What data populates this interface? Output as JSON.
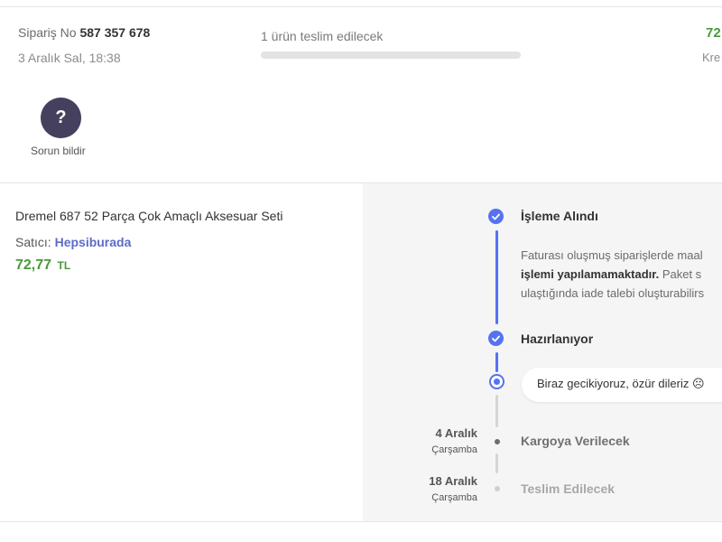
{
  "order": {
    "number_label": "Sipariş No",
    "number": "587 357 678",
    "date": "3 Aralık Sal, 18:38",
    "delivery_text": "1 ürün teslim edilecek",
    "delivery_progress": 0,
    "total_amount": "72",
    "total_label": "Kre"
  },
  "help": {
    "icon_text": "?",
    "label": "Sorun bildir"
  },
  "product": {
    "name": "Dremel 687 52 Parça Çok Amaçlı Aksesuar Seti",
    "seller_label": "Satıcı:",
    "seller_name": "Hepsiburada",
    "price": "72,77",
    "currency": "TL"
  },
  "tracking": {
    "steps": [
      {
        "title": "İşleme Alındı",
        "description_line1": "Faturası oluşmuş siparişlerde maal",
        "description_line2_bold": "işlemi yapılamamaktadır.",
        "description_line2_rest": " Paket s",
        "description_line3": "ulaştığında iade talebi oluşturabilirs"
      },
      {
        "title": "Hazırlanıyor"
      },
      {
        "delay_message": "Biraz gecikiyoruz, özür dileriz ☹"
      },
      {
        "title": "Kargoya Verilecek",
        "date": "4 Aralık",
        "day": "Çarşamba"
      },
      {
        "title": "Teslim Edilecek",
        "date": "18 Aralık",
        "day": "Çarşamba"
      }
    ]
  },
  "colors": {
    "accent_blue": "#5572f2",
    "price_green": "#4a9a3a",
    "help_button": "#45405e",
    "seller_link": "#5c6bc9",
    "panel_bg": "#f5f5f5"
  }
}
